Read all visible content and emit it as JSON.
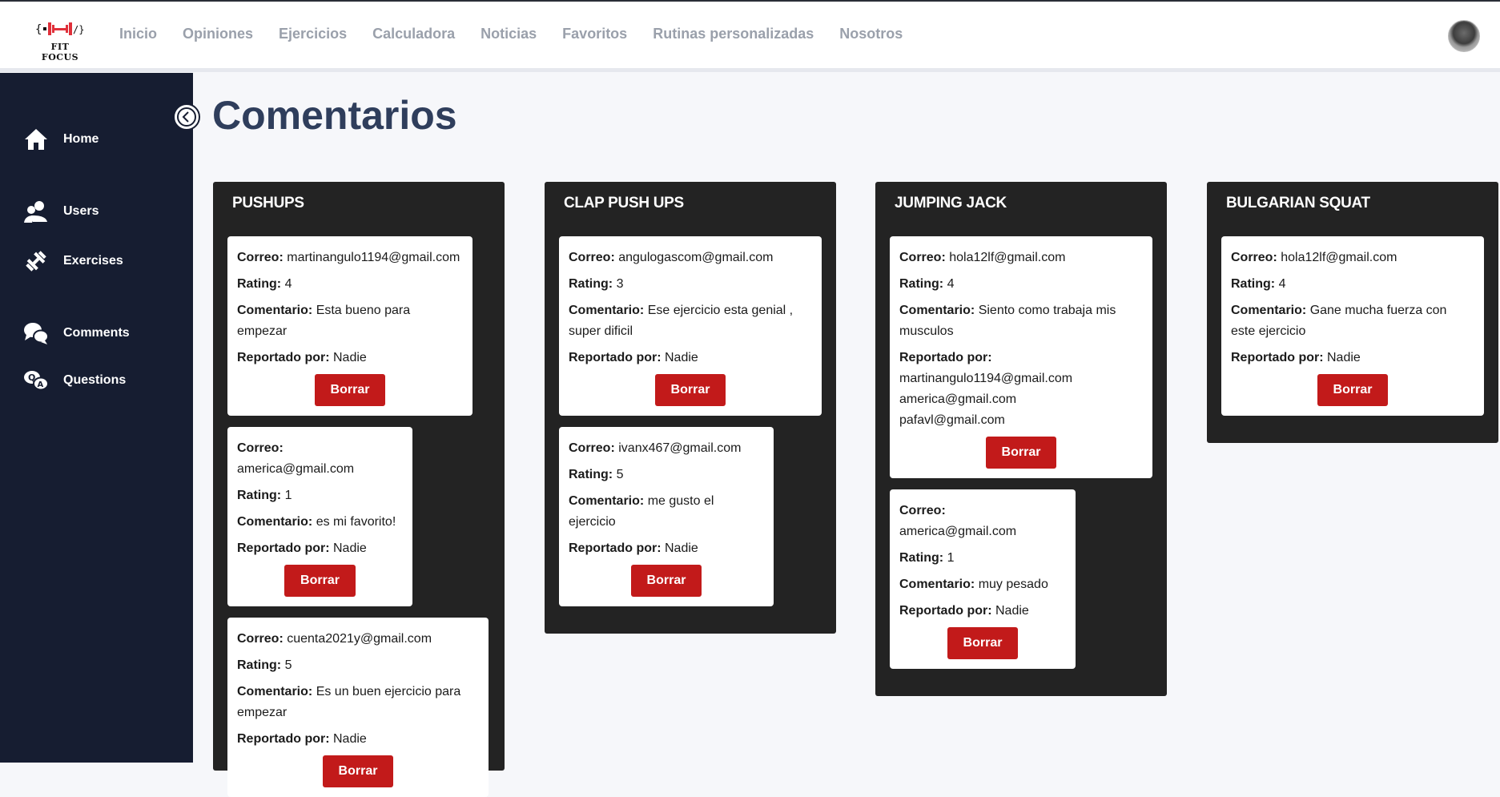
{
  "brand": {
    "logo_text": "FIT FOCUS"
  },
  "nav": [
    "Inicio",
    "Opiniones",
    "Ejercicios",
    "Calculadora",
    "Noticias",
    "Favoritos",
    "Rutinas personalizadas",
    "Nosotros"
  ],
  "sidebar": {
    "items": [
      {
        "label": "Home",
        "icon": "home-icon"
      },
      {
        "label": "Users",
        "icon": "users-icon"
      },
      {
        "label": "Exercises",
        "icon": "dumbbell-icon"
      },
      {
        "label": "Comments",
        "icon": "comments-icon"
      },
      {
        "label": "Questions",
        "icon": "questions-icon"
      }
    ]
  },
  "page_title": "Comentarios",
  "labels": {
    "correo": "Correo:",
    "rating": "Rating:",
    "comentario": "Comentario:",
    "reportado": "Reportado por:",
    "borrar": "Borrar"
  },
  "columns": [
    {
      "title": "PUSHUPS",
      "cards": [
        {
          "correo": "martinangulo1194@gmail.com",
          "rating": "4",
          "comentario": "Esta bueno para empezar",
          "reportado": "Nadie"
        },
        {
          "correo": "america@gmail.com",
          "rating": "1",
          "comentario": "es mi favorito!",
          "reportado": "Nadie"
        },
        {
          "correo": "cuenta2021y@gmail.com",
          "rating": "5",
          "comentario": "Es un buen ejercicio para empezar",
          "reportado": "Nadie"
        }
      ]
    },
    {
      "title": "CLAP PUSH UPS",
      "cards": [
        {
          "correo": "angulogascom@gmail.com",
          "rating": "3",
          "comentario": "Ese ejercicio esta genial , super dificil",
          "reportado": "Nadie"
        },
        {
          "correo": "ivanx467@gmail.com",
          "rating": "5",
          "comentario": "me gusto el ejercicio",
          "reportado": "Nadie"
        }
      ]
    },
    {
      "title": "JUMPING JACK",
      "cards": [
        {
          "correo": "hola12lf@gmail.com",
          "rating": "4",
          "comentario": "Siento como trabaja mis musculos",
          "reportado": "martinangulo1194@gmail.com america@gmail.com pafavl@gmail.com"
        },
        {
          "correo": "america@gmail.com",
          "rating": "1",
          "comentario": "muy pesado",
          "reportado": "Nadie"
        }
      ]
    },
    {
      "title": "BULGARIAN SQUAT",
      "cards": [
        {
          "correo": "hola12lf@gmail.com",
          "rating": "4",
          "comentario": "Gane mucha fuerza con este ejercicio",
          "reportado": "Nadie"
        }
      ]
    }
  ]
}
